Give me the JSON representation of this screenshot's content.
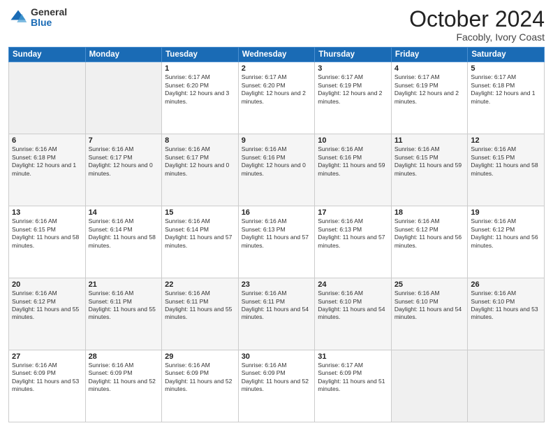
{
  "logo": {
    "general": "General",
    "blue": "Blue"
  },
  "header": {
    "month": "October 2024",
    "location": "Facobly, Ivory Coast"
  },
  "weekdays": [
    "Sunday",
    "Monday",
    "Tuesday",
    "Wednesday",
    "Thursday",
    "Friday",
    "Saturday"
  ],
  "weeks": [
    [
      {
        "day": "",
        "info": ""
      },
      {
        "day": "",
        "info": ""
      },
      {
        "day": "1",
        "info": "Sunrise: 6:17 AM\nSunset: 6:20 PM\nDaylight: 12 hours and 3 minutes."
      },
      {
        "day": "2",
        "info": "Sunrise: 6:17 AM\nSunset: 6:20 PM\nDaylight: 12 hours and 2 minutes."
      },
      {
        "day": "3",
        "info": "Sunrise: 6:17 AM\nSunset: 6:19 PM\nDaylight: 12 hours and 2 minutes."
      },
      {
        "day": "4",
        "info": "Sunrise: 6:17 AM\nSunset: 6:19 PM\nDaylight: 12 hours and 2 minutes."
      },
      {
        "day": "5",
        "info": "Sunrise: 6:17 AM\nSunset: 6:18 PM\nDaylight: 12 hours and 1 minute."
      }
    ],
    [
      {
        "day": "6",
        "info": "Sunrise: 6:16 AM\nSunset: 6:18 PM\nDaylight: 12 hours and 1 minute."
      },
      {
        "day": "7",
        "info": "Sunrise: 6:16 AM\nSunset: 6:17 PM\nDaylight: 12 hours and 0 minutes."
      },
      {
        "day": "8",
        "info": "Sunrise: 6:16 AM\nSunset: 6:17 PM\nDaylight: 12 hours and 0 minutes."
      },
      {
        "day": "9",
        "info": "Sunrise: 6:16 AM\nSunset: 6:16 PM\nDaylight: 12 hours and 0 minutes."
      },
      {
        "day": "10",
        "info": "Sunrise: 6:16 AM\nSunset: 6:16 PM\nDaylight: 11 hours and 59 minutes."
      },
      {
        "day": "11",
        "info": "Sunrise: 6:16 AM\nSunset: 6:15 PM\nDaylight: 11 hours and 59 minutes."
      },
      {
        "day": "12",
        "info": "Sunrise: 6:16 AM\nSunset: 6:15 PM\nDaylight: 11 hours and 58 minutes."
      }
    ],
    [
      {
        "day": "13",
        "info": "Sunrise: 6:16 AM\nSunset: 6:15 PM\nDaylight: 11 hours and 58 minutes."
      },
      {
        "day": "14",
        "info": "Sunrise: 6:16 AM\nSunset: 6:14 PM\nDaylight: 11 hours and 58 minutes."
      },
      {
        "day": "15",
        "info": "Sunrise: 6:16 AM\nSunset: 6:14 PM\nDaylight: 11 hours and 57 minutes."
      },
      {
        "day": "16",
        "info": "Sunrise: 6:16 AM\nSunset: 6:13 PM\nDaylight: 11 hours and 57 minutes."
      },
      {
        "day": "17",
        "info": "Sunrise: 6:16 AM\nSunset: 6:13 PM\nDaylight: 11 hours and 57 minutes."
      },
      {
        "day": "18",
        "info": "Sunrise: 6:16 AM\nSunset: 6:12 PM\nDaylight: 11 hours and 56 minutes."
      },
      {
        "day": "19",
        "info": "Sunrise: 6:16 AM\nSunset: 6:12 PM\nDaylight: 11 hours and 56 minutes."
      }
    ],
    [
      {
        "day": "20",
        "info": "Sunrise: 6:16 AM\nSunset: 6:12 PM\nDaylight: 11 hours and 55 minutes."
      },
      {
        "day": "21",
        "info": "Sunrise: 6:16 AM\nSunset: 6:11 PM\nDaylight: 11 hours and 55 minutes."
      },
      {
        "day": "22",
        "info": "Sunrise: 6:16 AM\nSunset: 6:11 PM\nDaylight: 11 hours and 55 minutes."
      },
      {
        "day": "23",
        "info": "Sunrise: 6:16 AM\nSunset: 6:11 PM\nDaylight: 11 hours and 54 minutes."
      },
      {
        "day": "24",
        "info": "Sunrise: 6:16 AM\nSunset: 6:10 PM\nDaylight: 11 hours and 54 minutes."
      },
      {
        "day": "25",
        "info": "Sunrise: 6:16 AM\nSunset: 6:10 PM\nDaylight: 11 hours and 54 minutes."
      },
      {
        "day": "26",
        "info": "Sunrise: 6:16 AM\nSunset: 6:10 PM\nDaylight: 11 hours and 53 minutes."
      }
    ],
    [
      {
        "day": "27",
        "info": "Sunrise: 6:16 AM\nSunset: 6:09 PM\nDaylight: 11 hours and 53 minutes."
      },
      {
        "day": "28",
        "info": "Sunrise: 6:16 AM\nSunset: 6:09 PM\nDaylight: 11 hours and 52 minutes."
      },
      {
        "day": "29",
        "info": "Sunrise: 6:16 AM\nSunset: 6:09 PM\nDaylight: 11 hours and 52 minutes."
      },
      {
        "day": "30",
        "info": "Sunrise: 6:16 AM\nSunset: 6:09 PM\nDaylight: 11 hours and 52 minutes."
      },
      {
        "day": "31",
        "info": "Sunrise: 6:17 AM\nSunset: 6:09 PM\nDaylight: 11 hours and 51 minutes."
      },
      {
        "day": "",
        "info": ""
      },
      {
        "day": "",
        "info": ""
      }
    ]
  ]
}
